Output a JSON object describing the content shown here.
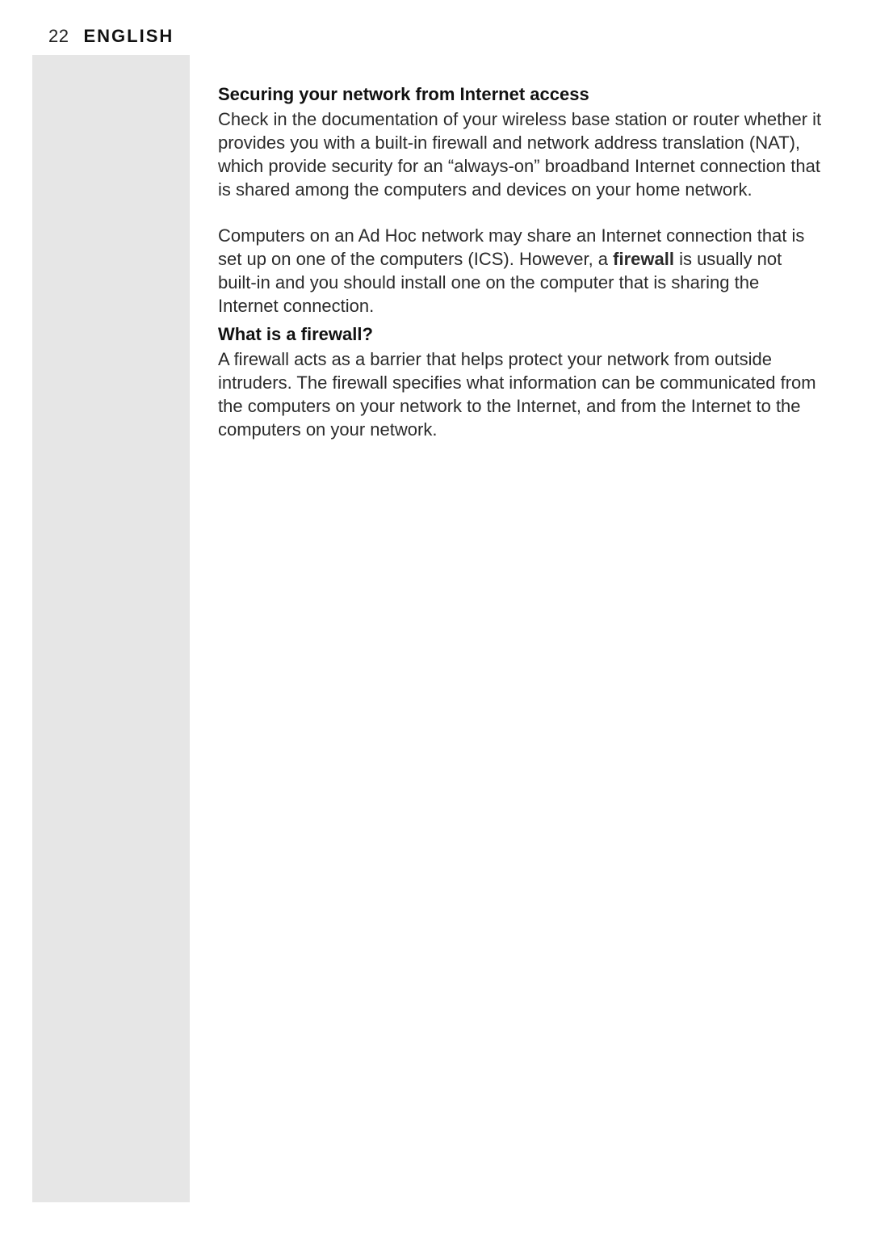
{
  "header": {
    "page_number": "22",
    "language": "ENGLISH"
  },
  "sections": {
    "s1": {
      "title": "Securing your network from Internet access",
      "p1": "Check in the documentation of your wireless base station or router whether it provides you with a built-in firewall and network address translation (NAT), which provide security for an “always-on” broadband Internet connection that is shared among the computers and devices on your home network.",
      "p2_pre": "Computers on an Ad Hoc network may share an Internet connection that is set up on one of the computers (ICS). However, a ",
      "p2_bold": "firewall",
      "p2_post": " is usually not built-in and you should install one on the computer that is sharing the Internet connection."
    },
    "s2": {
      "title": "What is a firewall?",
      "p1": "A firewall acts as a barrier that helps protect your network from outside intruders. The firewall specifies what information can be communicated from the computers on your network to the Internet, and from the Internet to the computers on your network."
    }
  }
}
